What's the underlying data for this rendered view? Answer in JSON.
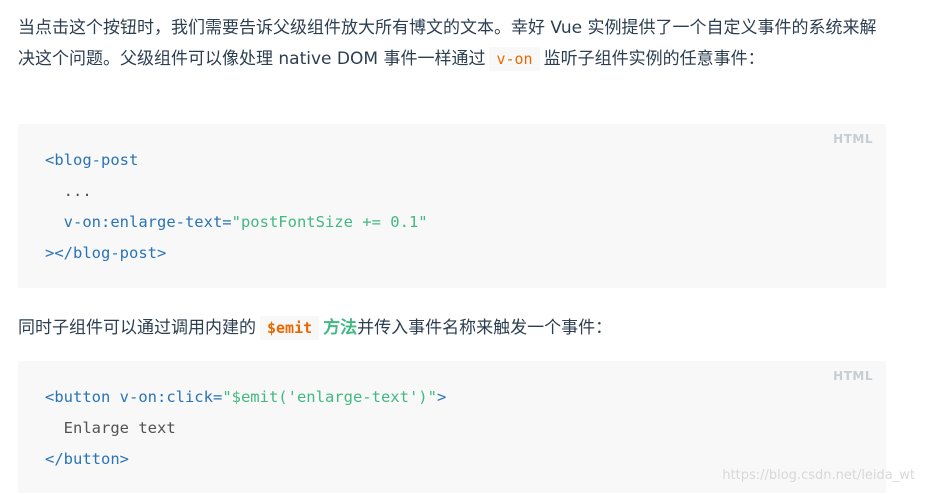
{
  "paragraph1": {
    "text_before": "当点击这个按钮时，我们需要告诉父级组件放大所有博文的文本。幸好 Vue 实例提供了一个自定义事件的系统来解决这个问题。父级组件可以像处理 native DOM 事件一样通过",
    "code": "v-on",
    "text_after": "监听子组件实例的任意事件："
  },
  "codeblock1": {
    "lang": "HTML",
    "line1_tag": "<blog-post",
    "line2": "  ...",
    "line3_attr": "  v-on:enlarge-text=",
    "line3_str": "\"postFontSize += 0.1\"",
    "line4_tag": "></blog-post>"
  },
  "paragraph2": {
    "text_before": "同时子组件可以通过调用内建的",
    "code": "$emit",
    "link": "方法",
    "text_after": "并传入事件名称来触发一个事件："
  },
  "codeblock2": {
    "lang": "HTML",
    "line1_tag": "<button v-on:click=",
    "line1_str": "\"$emit('enlarge-text')\"",
    "line1_end": ">",
    "line2": "  Enlarge text",
    "line3_tag": "</button>"
  },
  "watermark": "https://blog.csdn.net/leida_wt"
}
